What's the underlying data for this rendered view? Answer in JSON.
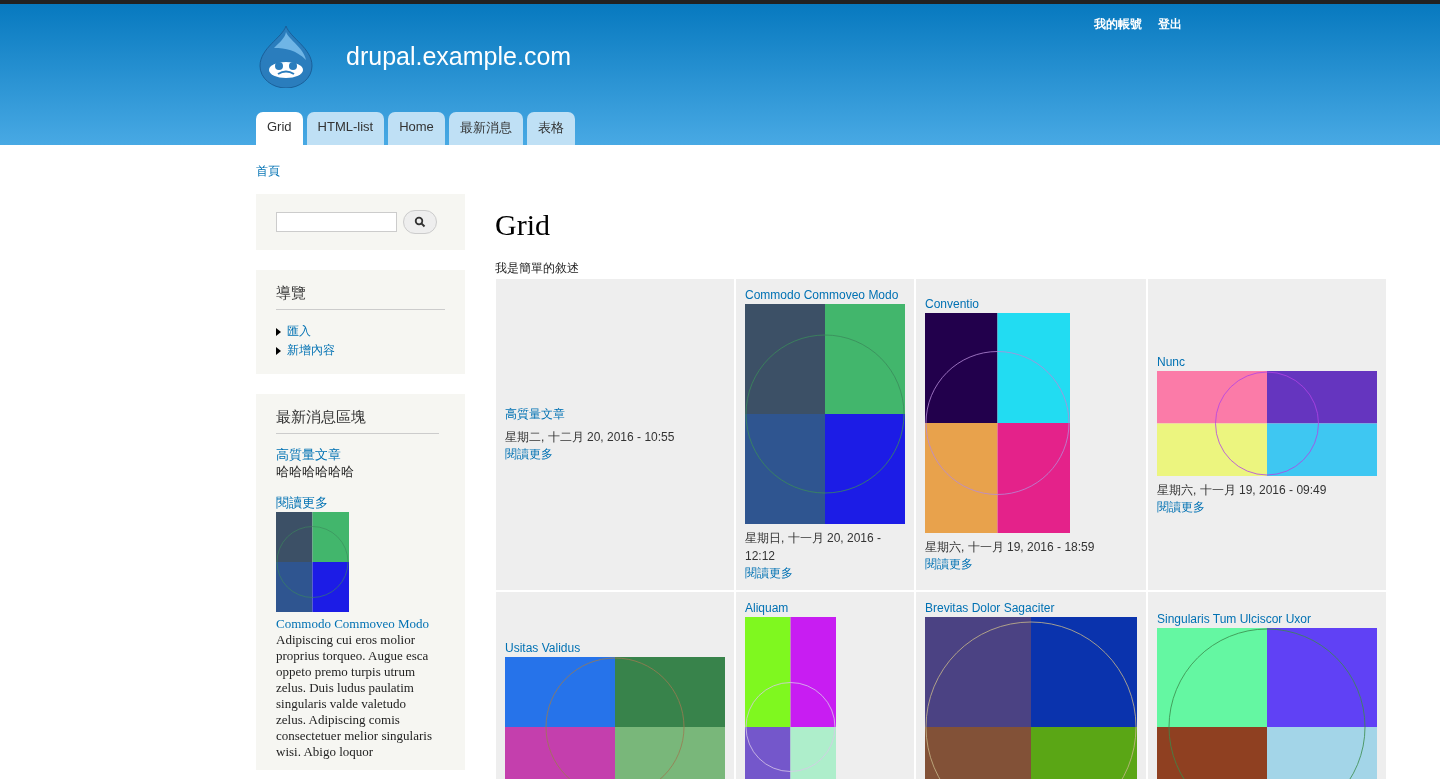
{
  "header": {
    "site_name": "drupal.example.com",
    "secondary_menu": [
      {
        "label": "我的帳號"
      },
      {
        "label": "登出"
      }
    ]
  },
  "tabs": [
    {
      "label": "Grid",
      "selected": true
    },
    {
      "label": "HTML-list",
      "selected": false
    },
    {
      "label": "Home",
      "selected": false
    },
    {
      "label": "最新消息",
      "selected": false
    },
    {
      "label": "表格",
      "selected": false
    }
  ],
  "breadcrumb": [
    "首頁"
  ],
  "navigation": {
    "title": "導覽",
    "items": [
      {
        "label": "匯入"
      },
      {
        "label": "新增內容"
      }
    ]
  },
  "news_block": {
    "title": "最新消息區塊",
    "items": [
      {
        "title": "高質量文章",
        "summary": "哈哈哈哈哈哈",
        "read_more": "閱讀更多"
      },
      {
        "title": "Commodo Commoveo Modo",
        "body": "Adipiscing cui eros molior proprius torqueo. Augue esca oppeto premo turpis utrum zelus. Duis ludus paulatim singularis valde valetudo zelus. Adipiscing comis consectetuer melior singularis wisi. Abigo loquor"
      }
    ]
  },
  "main": {
    "title": "Grid",
    "description": "我是簡單的敘述",
    "grid": [
      [
        {
          "title": "高質量文章",
          "date": "星期二, 十二月 20, 2016 - 10:55",
          "read_more": "閱讀更多"
        },
        {
          "title": "Commodo Commoveo Modo",
          "date": "星期日, 十一月 20, 2016 - 12:12",
          "read_more": "閱讀更多"
        },
        {
          "title": "Conventio",
          "date": "星期六, 十一月 19, 2016 - 18:59",
          "read_more": "閱讀更多"
        },
        {
          "title": "Nunc",
          "date": "星期六, 十一月 19, 2016 - 09:49",
          "read_more": "閱讀更多"
        }
      ],
      [
        {
          "title": "Usitas Validus"
        },
        {
          "title": "Aliquam"
        },
        {
          "title": "Brevitas Dolor Sagaciter"
        },
        {
          "title": "Singularis Tum Ulciscor Uxor"
        }
      ]
    ]
  }
}
